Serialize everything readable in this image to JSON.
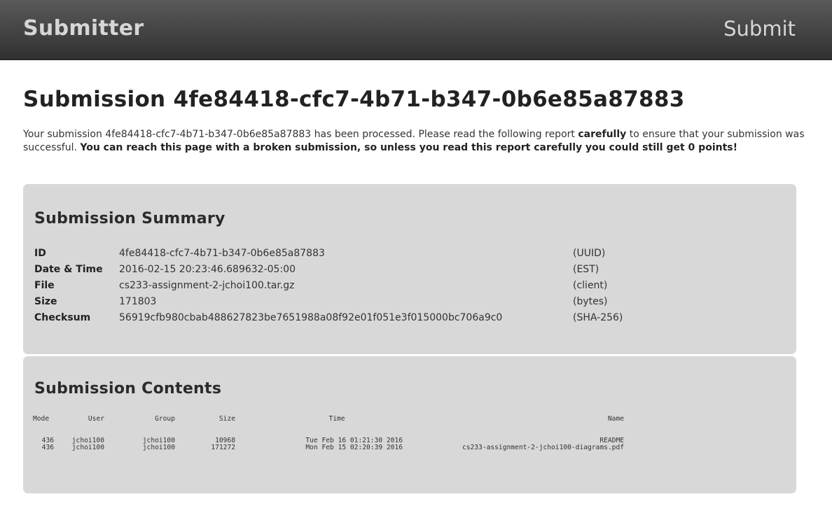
{
  "navbar": {
    "brand": "Submitter",
    "submit_link": "Submit"
  },
  "page": {
    "title": "Submission 4fe84418-cfc7-4b71-b347-0b6e85a87883",
    "intro_part1": "Your submission 4fe84418-cfc7-4b71-b347-0b6e85a87883 has been processed. Please read the following report ",
    "intro_emphasis": "carefully",
    "intro_part2": " to ensure that your submission was successful. ",
    "intro_warning": "You can reach this page with a broken submission, so unless you read this report carefully you could still get 0 points!"
  },
  "summary": {
    "title": "Submission Summary",
    "rows": [
      {
        "key": "ID",
        "value": "4fe84418-cfc7-4b71-b347-0b6e85a87883",
        "unit": "(UUID)"
      },
      {
        "key": "Date & Time",
        "value": "2016-02-15 20:23:46.689632-05:00",
        "unit": "(EST)"
      },
      {
        "key": "File",
        "value": "cs233-assignment-2-jchoi100.tar.gz",
        "unit": "(client)"
      },
      {
        "key": "Size",
        "value": "171803",
        "unit": "(bytes)"
      },
      {
        "key": "Checksum",
        "value": "56919cfb980cbab488627823be7651988a08f92e01f051e3f015000bc706a9c0",
        "unit": "(SHA-256)"
      }
    ]
  },
  "contents": {
    "title": "Submission Contents",
    "headers": {
      "mode": "Mode",
      "user": "User",
      "group": "Group",
      "size": "Size",
      "time": "Time",
      "name": "Name"
    },
    "files": [
      {
        "mode": "436",
        "user": "jchoi100",
        "group": "jchoi100",
        "size": "10968",
        "time": "Tue Feb 16 01:21:30 2016",
        "name": "README"
      },
      {
        "mode": "436",
        "user": "jchoi100",
        "group": "jchoi100",
        "size": "171272",
        "time": "Mon Feb 15 02:20:39 2016",
        "name": "cs233-assignment-2-jchoi100-diagrams.pdf"
      }
    ]
  }
}
